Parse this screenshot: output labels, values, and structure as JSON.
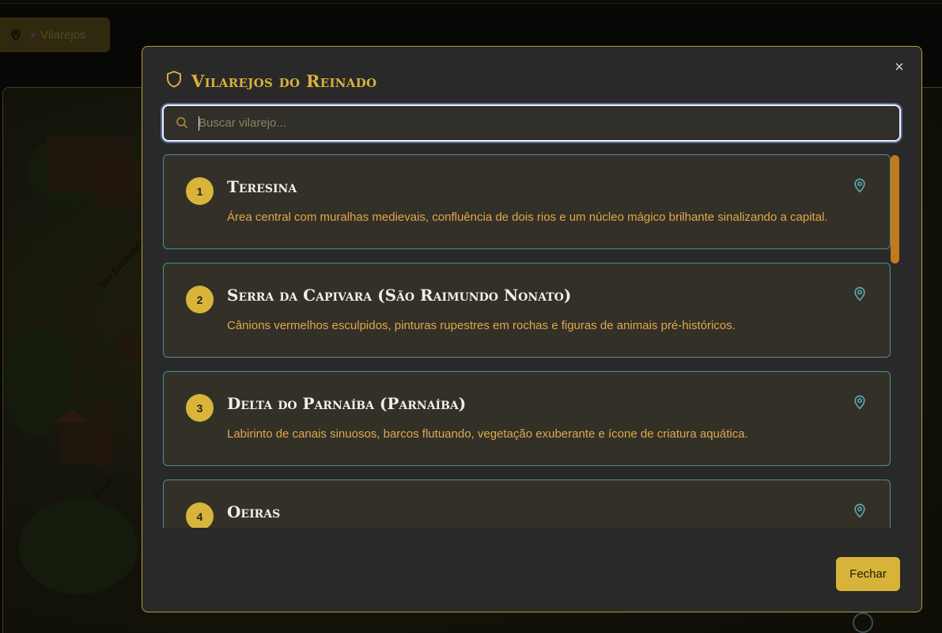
{
  "background": {
    "filter_chip": {
      "label": "Vilarejos",
      "icon": "map-pin-icon",
      "emoji_icon": "pin-emoji-icon"
    },
    "map_labels": [
      "São Raimundo Nonato",
      "Jaicós"
    ]
  },
  "modal": {
    "title": "Vilarejos do Reinado",
    "title_icon": "shield-icon",
    "close_label": "×",
    "search": {
      "placeholder": "Buscar vilarejo...",
      "value": ""
    },
    "villages": [
      {
        "number": "1",
        "name": "Teresina",
        "description": "Área central com muralhas medievais, confluência de dois rios e um núcleo mágico brilhante sinalizando a capital."
      },
      {
        "number": "2",
        "name": "Serra da Capivara (São Raimundo Nonato)",
        "description": "Cânions vermelhos esculpidos, pinturas rupestres em rochas e figuras de animais pré-históricos."
      },
      {
        "number": "3",
        "name": "Delta do Parnaíba (Parnaíba)",
        "description": "Labirinto de canais sinuosos, barcos flutuando, vegetação exuberante e ícone de criatura aquática."
      },
      {
        "number": "4",
        "name": "Oeiras",
        "description": ""
      }
    ],
    "close_button": "Fechar"
  },
  "colors": {
    "accent_gold": "#d7b33a",
    "card_border": "#4c8f92",
    "description_text": "#e0a84a",
    "scroll_thumb": "#c27a1c"
  }
}
